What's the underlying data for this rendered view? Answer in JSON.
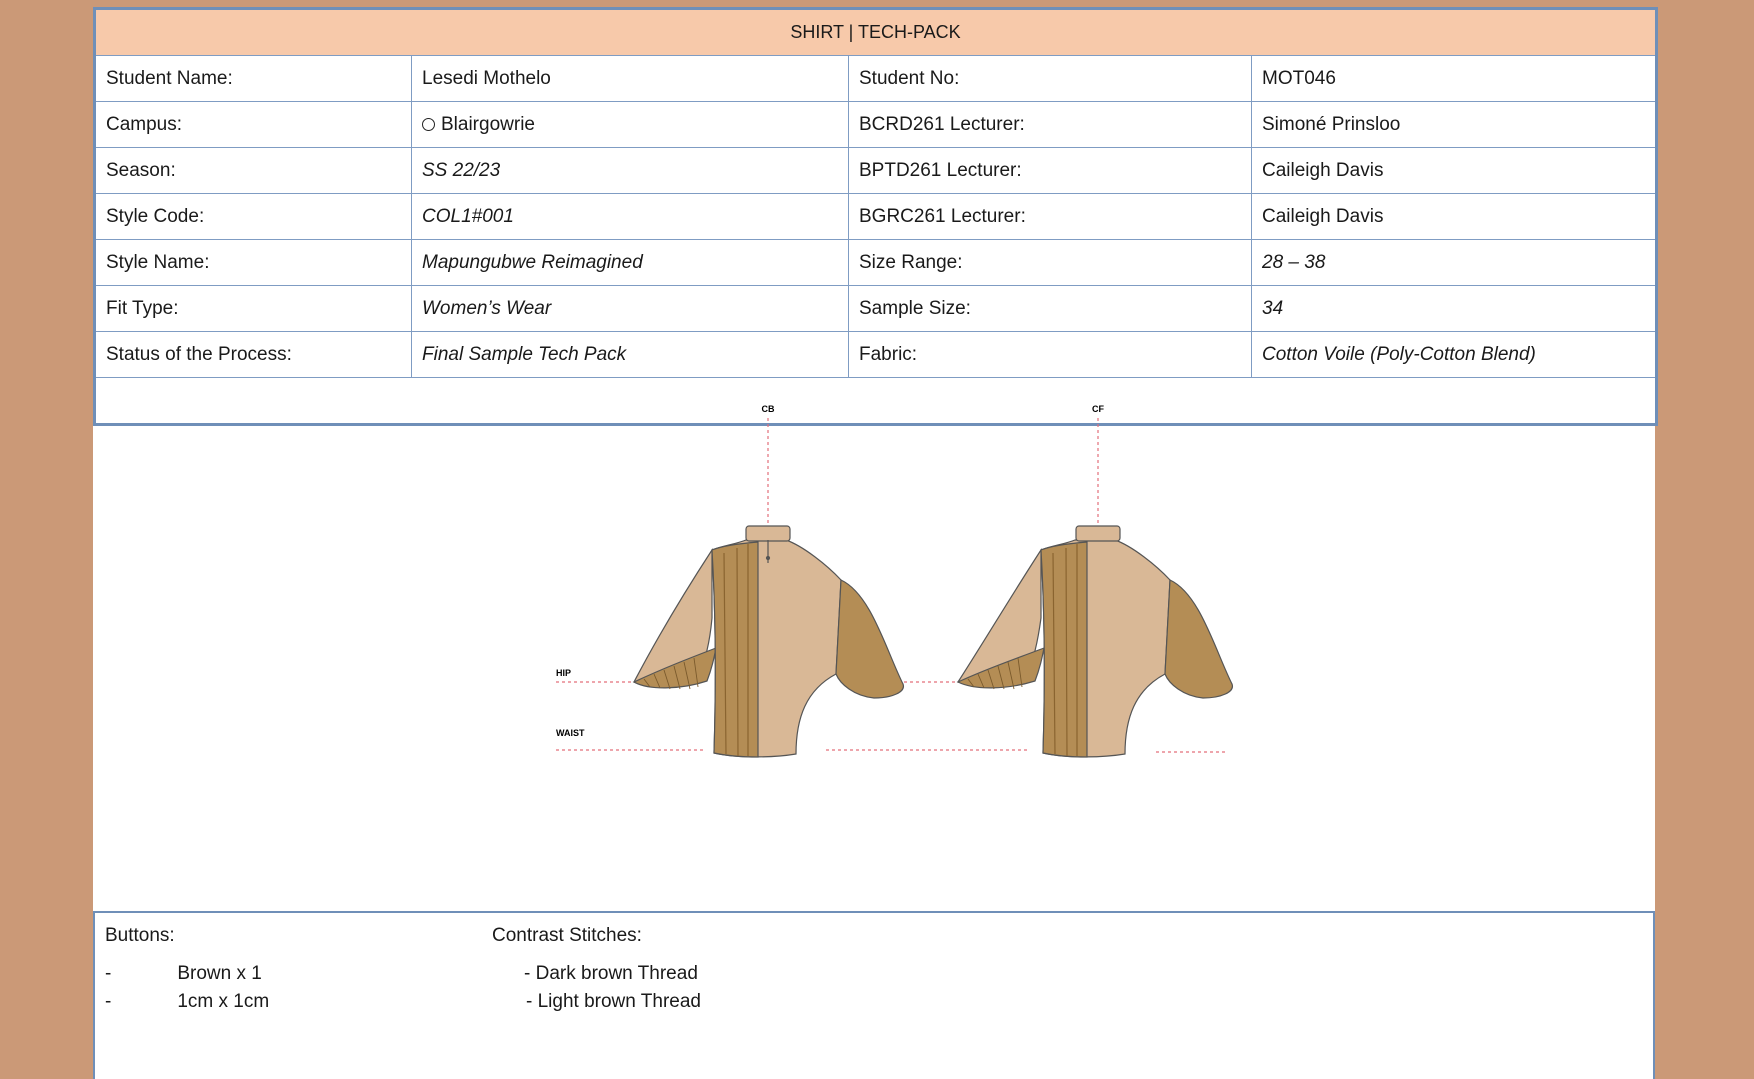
{
  "header": {
    "title": "SHIRT | TECH-PACK"
  },
  "info_rows": [
    {
      "label1": "Student Name:",
      "value1": "Lesedi Mothelo",
      "label2": "Student No:",
      "value2": "MOT046"
    },
    {
      "label1": "Campus:",
      "value1": "Blairgowrie",
      "label2": "BCRD261 Lecturer:",
      "value2": "Simoné Prinsloo"
    },
    {
      "label1": "Season:",
      "value1": "SS 22/23",
      "label2": "BPTD261 Lecturer:",
      "value2": "Caileigh Davis"
    },
    {
      "label1": "Style Code:",
      "value1": "COL1#001",
      "label2": "BGRC261 Lecturer:",
      "value2": "Caileigh Davis"
    },
    {
      "label1": "Style Name:",
      "value1": "Mapungubwe Reimagined",
      "label2": "Size Range:",
      "value2": "28 – 38"
    },
    {
      "label1": "Fit Type:",
      "value1": "Women’s Wear",
      "label2": "Sample Size:",
      "value2": "34"
    },
    {
      "label1": "Status of the Process:",
      "value1": "Final Sample Tech Pack",
      "label2": "Fabric:",
      "value2": "Cotton Voile (Poly-Cotton Blend)"
    }
  ],
  "sketch": {
    "back_marker": "CB",
    "front_marker": "CF",
    "hip_label": "HIP",
    "waist_label": "WAIST",
    "colors": {
      "light_fabric": "#d9b896",
      "dark_fabric": "#b48d55",
      "stripe": "#8a6430",
      "guide": "#e36f7a"
    }
  },
  "notes": {
    "buttons_title": "Buttons:",
    "buttons_items": [
      "Brown x 1",
      "1cm x 1cm"
    ],
    "stitches_title": "Contrast Stitches:",
    "stitches_items": [
      "- Dark brown Thread",
      "- Light brown Thread"
    ]
  }
}
